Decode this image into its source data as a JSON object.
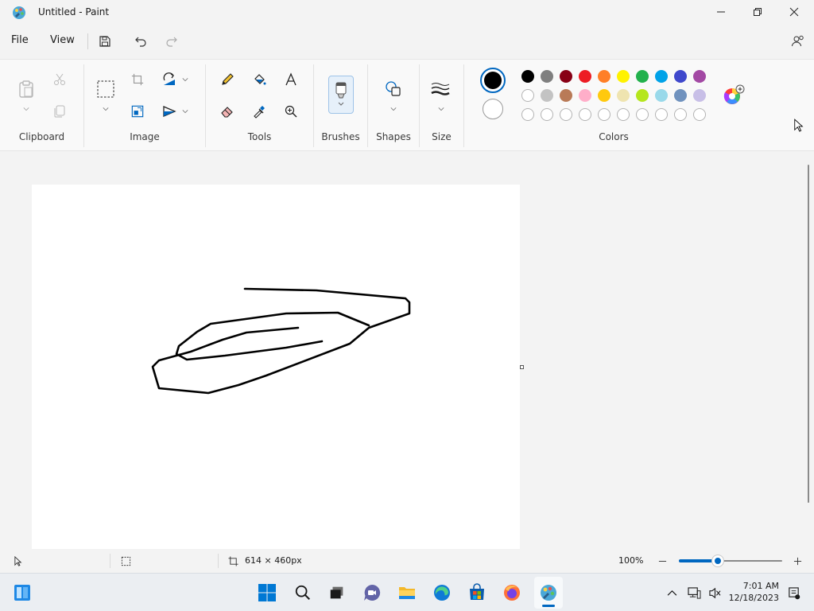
{
  "window": {
    "title": "Untitled - Paint"
  },
  "menu": {
    "file": "File",
    "view": "View"
  },
  "ribbon": {
    "groups": {
      "clipboard": "Clipboard",
      "image": "Image",
      "tools": "Tools",
      "brushes": "Brushes",
      "shapes": "Shapes",
      "size": "Size",
      "colors": "Colors"
    },
    "primary_color": "#000000",
    "secondary_color": "#ffffff",
    "palette_row1": [
      "#000000",
      "#7f7f7f",
      "#880015",
      "#ed1c24",
      "#ff7f27",
      "#fff200",
      "#22b14c",
      "#00a2e8",
      "#3f48cc",
      "#a349a4"
    ],
    "palette_row2": [
      "#ffffff",
      "#c3c3c3",
      "#b97a57",
      "#ffaec9",
      "#ffc90e",
      "#efe4b0",
      "#b5e61d",
      "#99d9ea",
      "#7092be",
      "#c8bfe7"
    ],
    "palette_row3_empty": 10
  },
  "status": {
    "canvas_size": "614 × 460px",
    "zoom": "100%",
    "zoom_level_fraction": 0.38
  },
  "taskbar": {
    "time": "7:01 AM",
    "date": "12/18/2023"
  },
  "colors": {
    "accent": "#0067c0"
  }
}
